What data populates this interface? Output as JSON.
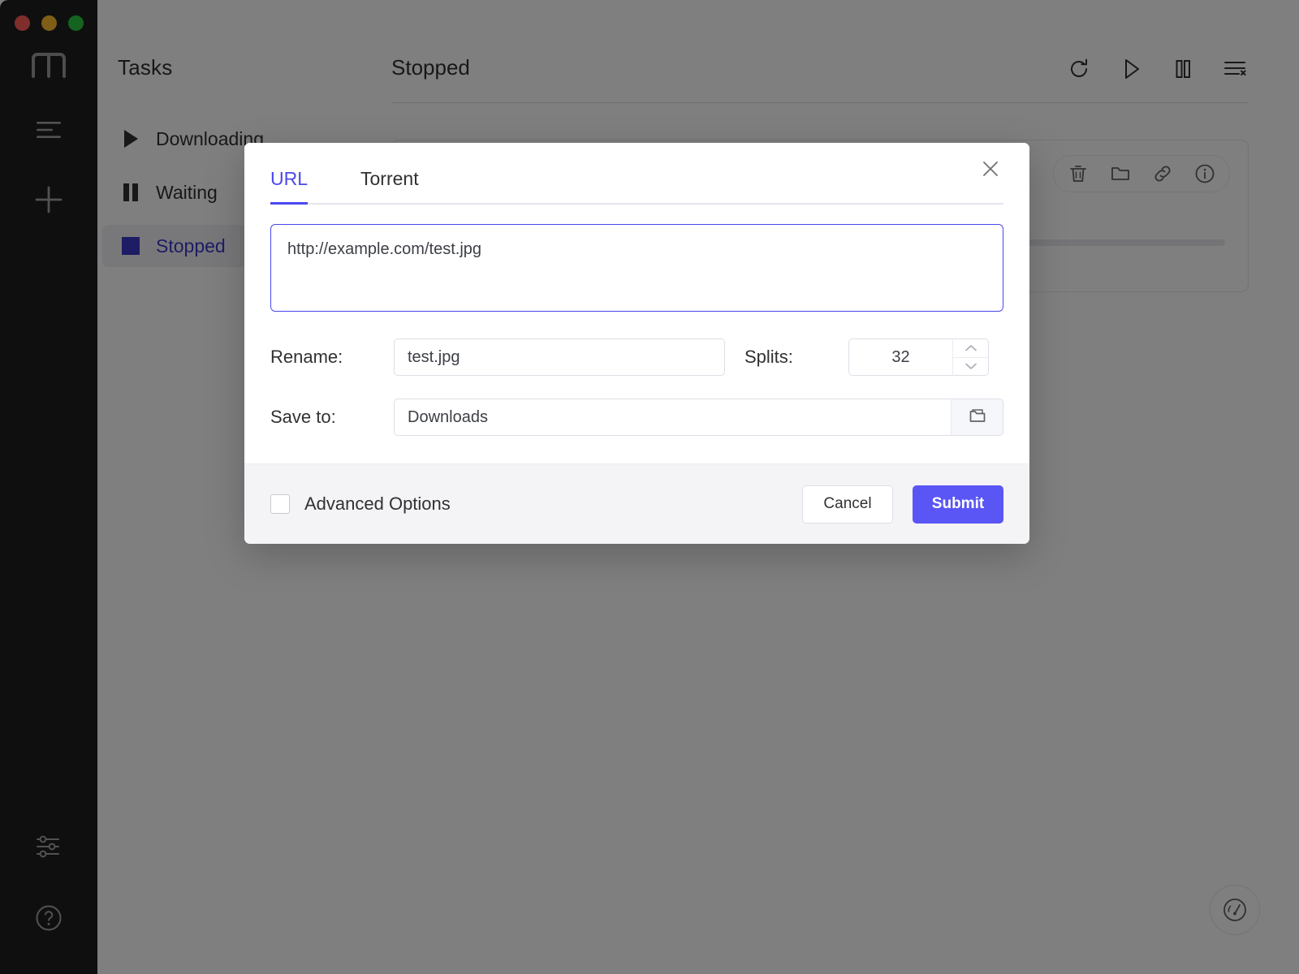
{
  "window": {
    "traffic_lights": [
      {
        "name": "close",
        "color": "#ff5f57"
      },
      {
        "name": "minimize",
        "color": "#febc2e"
      },
      {
        "name": "zoom",
        "color": "#28c840"
      }
    ]
  },
  "rail": {
    "logo": "m-logo-icon",
    "items": [
      {
        "icon": "list-lines-icon",
        "name": "task-list"
      },
      {
        "icon": "plus-icon",
        "name": "add-task"
      }
    ],
    "bottom_items": [
      {
        "icon": "sliders-icon",
        "name": "preferences"
      },
      {
        "icon": "question-circle-icon",
        "name": "help"
      }
    ]
  },
  "tasks_panel": {
    "title": "Tasks",
    "items": [
      {
        "label": "Downloading",
        "icon": "play-triangle-icon",
        "active": false
      },
      {
        "label": "Waiting",
        "icon": "pause-bars-icon",
        "active": false
      },
      {
        "label": "Stopped",
        "icon": "stop-square-icon",
        "active": true
      }
    ]
  },
  "main": {
    "title": "Stopped",
    "toolbar": [
      {
        "icon": "refresh-icon",
        "name": "refresh"
      },
      {
        "icon": "play-icon",
        "name": "resume-all"
      },
      {
        "icon": "pause-icon",
        "name": "pause-all"
      },
      {
        "icon": "clear-list-icon",
        "name": "clear-list"
      }
    ],
    "task_card": {
      "actions": [
        {
          "icon": "trash-icon",
          "name": "delete-task"
        },
        {
          "icon": "folder-icon",
          "name": "open-folder"
        },
        {
          "icon": "link-icon",
          "name": "copy-link"
        },
        {
          "icon": "info-circle-icon",
          "name": "task-info"
        }
      ],
      "progress_percent": 0
    },
    "fab": {
      "icon": "gauge-icon",
      "name": "speed-limit"
    }
  },
  "modal": {
    "tabs": [
      {
        "label": "URL",
        "active": true
      },
      {
        "label": "Torrent",
        "active": false
      }
    ],
    "close_icon": "close-icon",
    "url": {
      "value": "http://example.com/test.jpg",
      "placeholder": "http://example.com/test.jpg"
    },
    "rename": {
      "label": "Rename:",
      "value": "test.jpg",
      "placeholder": "test.jpg"
    },
    "splits": {
      "label": "Splits:",
      "value": "32",
      "placeholder": "32"
    },
    "save_to": {
      "label": "Save to:",
      "value": "Downloads",
      "placeholder": "Downloads",
      "browse_icon": "folder-icon"
    },
    "advanced_options": {
      "label": "Advanced Options",
      "checked": false
    },
    "cancel_label": "Cancel",
    "submit_label": "Submit"
  },
  "colors": {
    "accent": "#5a56f5",
    "tab_active": "#4b48f0",
    "rail_bg": "#1f1f1f",
    "footer_bg": "#f4f4f6",
    "overlay": "rgba(0,0,0,0.5)"
  }
}
